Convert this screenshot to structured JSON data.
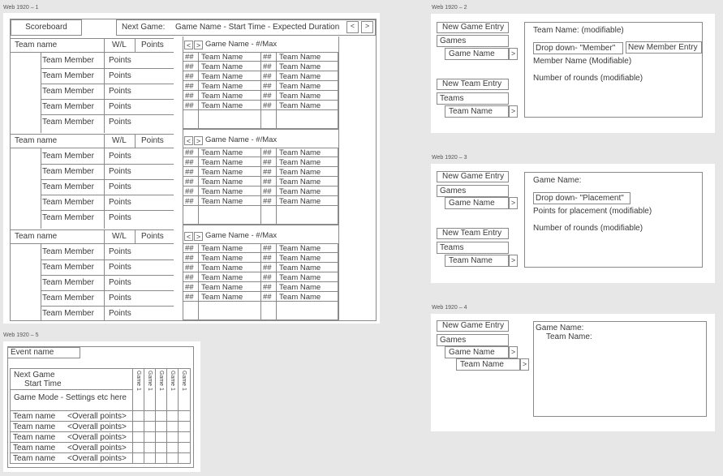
{
  "artboards": {
    "a1": "Web 1920 – 1",
    "a2": "Web 1920 – 2",
    "a3": "Web 1920 – 3",
    "a4": "Web 1920 – 4",
    "a5": "Web 1920 – 5"
  },
  "scoreboard": {
    "title": "Scoreboard",
    "next_game_label": "Next Game:",
    "next_game_value": "Game Name - Start Time - Expected Duration",
    "prev": "<",
    "next": ">",
    "team_header": "Team name",
    "wl_header": "W/L",
    "points_header": "Points",
    "member_label": "Team Member",
    "member_points": "Points",
    "game_header": "Game Name - #/Max",
    "num": "##",
    "team_cell": "Team Name"
  },
  "page2": {
    "new_game": "New Game Entry",
    "games": "Games",
    "game_name": "Game Name",
    "new_team": "New Team Entry",
    "teams": "Teams",
    "team_name": "Team Name",
    "expand": ">",
    "team_name_field": "Team Name: (modifiable)",
    "dropdown": "Drop down- \"Member\"",
    "new_member": "New Member Entry",
    "member_name": "Member Name (Modifiable)",
    "rounds": "Number of rounds (modifiable)"
  },
  "page3": {
    "new_game": "New Game Entry",
    "games": "Games",
    "game_name": "Game Name",
    "new_team": "New Team Entry",
    "teams": "Teams",
    "team_name": "Team Name",
    "expand": ">",
    "game_name_field": "Game Name:",
    "dropdown": "Drop down- \"Placement\"",
    "points_placement": "Points for placement (modifiable)",
    "rounds": "Number of rounds (modifiable)"
  },
  "page4": {
    "new_game": "New Game Entry",
    "games": "Games",
    "game_name": "Game Name",
    "team_name": "Team Name",
    "expand": ">",
    "panel_game": "Game Name:",
    "panel_team": "Team Name:"
  },
  "page5": {
    "event_name": "Event name",
    "next_game": "Next Game",
    "start_time": "Start Time",
    "game_mode": "Game Mode - Settings etc here",
    "col_game": "Game 1",
    "team_name": "Team name",
    "overall": "<Overall points>"
  }
}
